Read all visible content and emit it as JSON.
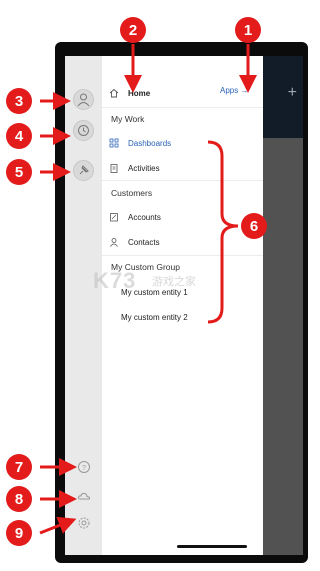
{
  "nav": {
    "home": "Home",
    "apps": "Apps →",
    "sections": {
      "my_work": "My Work",
      "customers": "Customers",
      "custom_group": "My Custom Group"
    },
    "items": {
      "dashboards": "Dashboards",
      "activities": "Activities",
      "accounts": "Accounts",
      "contacts": "Contacts",
      "custom1": "My custom entity 1",
      "custom2": "My custom entity 2"
    }
  },
  "callouts": [
    "1",
    "2",
    "3",
    "4",
    "5",
    "6",
    "7",
    "8",
    "9"
  ],
  "watermark": {
    "logo": "K73",
    "text": "游戏之家"
  },
  "colors": {
    "accent": "#2a62b8",
    "callout": "#e31b1b"
  },
  "icons": {
    "home": "home-icon",
    "dashboards": "dashboard-icon",
    "activities": "clipboard-icon",
    "accounts": "building-icon",
    "contacts": "person-icon",
    "profile": "profile-icon",
    "recent": "clock-icon",
    "pinned": "pin-icon",
    "help": "help-icon",
    "sync": "cloud-icon",
    "settings": "gear-icon"
  }
}
